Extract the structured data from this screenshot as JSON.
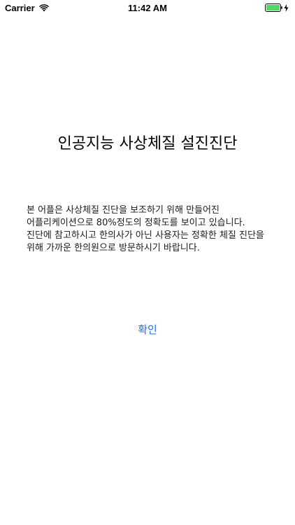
{
  "status_bar": {
    "carrier": "Carrier",
    "time": "11:42 AM",
    "wifi_icon": "wifi-icon",
    "battery_icon": "battery-icon",
    "charging_icon": "charging-bolt-icon",
    "battery_color": "#4cd964"
  },
  "main": {
    "title": "인공지능 사상체질 설진진단",
    "description": "본 어플은 사상체질 진단을 보조하기 위해 만들어진 어플리케이션으로 80%정도의 정확도를 보이고 있습니다. 진단에 참고하시고 한의사가 아닌 사용자는 정확한 체질 진단을 위해 가까운 한의원으로 방문하시기 바랍니다.",
    "confirm_label": "확인",
    "accent_color": "#1c72d9"
  }
}
